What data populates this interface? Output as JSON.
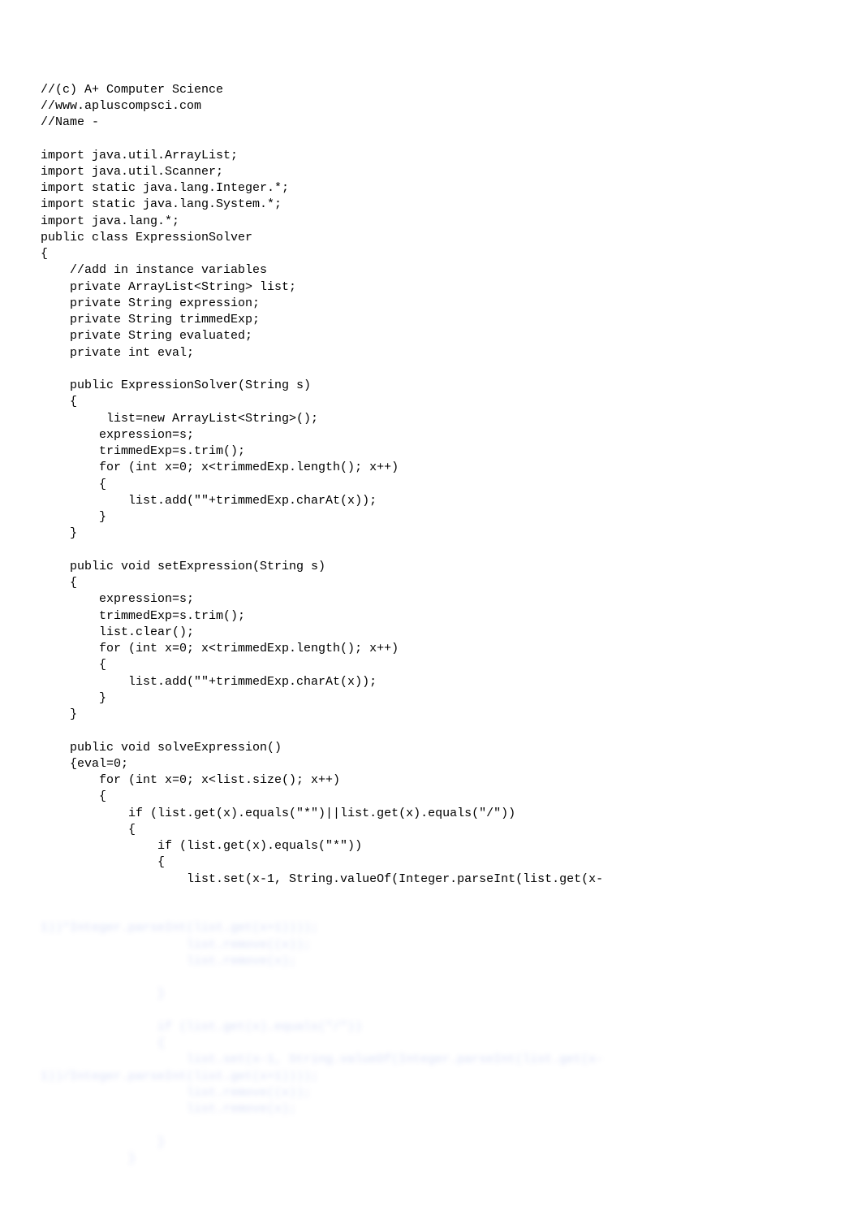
{
  "code": {
    "lines": [
      "//(c) A+ Computer Science",
      "//www.apluscompsci.com",
      "//Name -",
      "",
      "import java.util.ArrayList;",
      "import java.util.Scanner;",
      "import static java.lang.Integer.*;",
      "import static java.lang.System.*;",
      "import java.lang.*;",
      "public class ExpressionSolver",
      "{",
      "    //add in instance variables",
      "    private ArrayList<String> list;",
      "    private String expression;",
      "    private String trimmedExp;",
      "    private String evaluated;",
      "    private int eval;",
      "",
      "    public ExpressionSolver(String s)",
      "    {",
      "         list=new ArrayList<String>();",
      "        expression=s;",
      "        trimmedExp=s.trim();",
      "        for (int x=0; x<trimmedExp.length(); x++)",
      "        {",
      "            list.add(\"\"+trimmedExp.charAt(x));",
      "        }",
      "    }",
      "",
      "    public void setExpression(String s)",
      "    {",
      "        expression=s;",
      "        trimmedExp=s.trim();",
      "        list.clear();",
      "        for (int x=0; x<trimmedExp.length(); x++)",
      "        {",
      "            list.add(\"\"+trimmedExp.charAt(x));",
      "        }",
      "    }",
      "",
      "    public void solveExpression()",
      "    {eval=0;",
      "        for (int x=0; x<list.size(); x++)",
      "        {",
      "            if (list.get(x).equals(\"*\")||list.get(x).equals(\"/\"))",
      "            {",
      "                if (list.get(x).equals(\"*\"))",
      "                {",
      "                    list.set(x-1, String.valueOf(Integer.parseInt(list.get(x-"
    ],
    "blurred": [
      "1))*Integer.parseInt(list.get(x+1))));",
      "                    list.remove((x));",
      "                    list.remove(x);",
      "",
      "                }",
      "",
      "                if (list.get(x).equals(\"/\"))",
      "                {",
      "                    list.set(x-1, String.valueOf(Integer.parseInt(list.get(x-",
      "1))/Integer.parseInt(list.get(x+1))));",
      "                    list.remove((x));",
      "                    list.remove(x);",
      "",
      "                }",
      "            }"
    ]
  }
}
